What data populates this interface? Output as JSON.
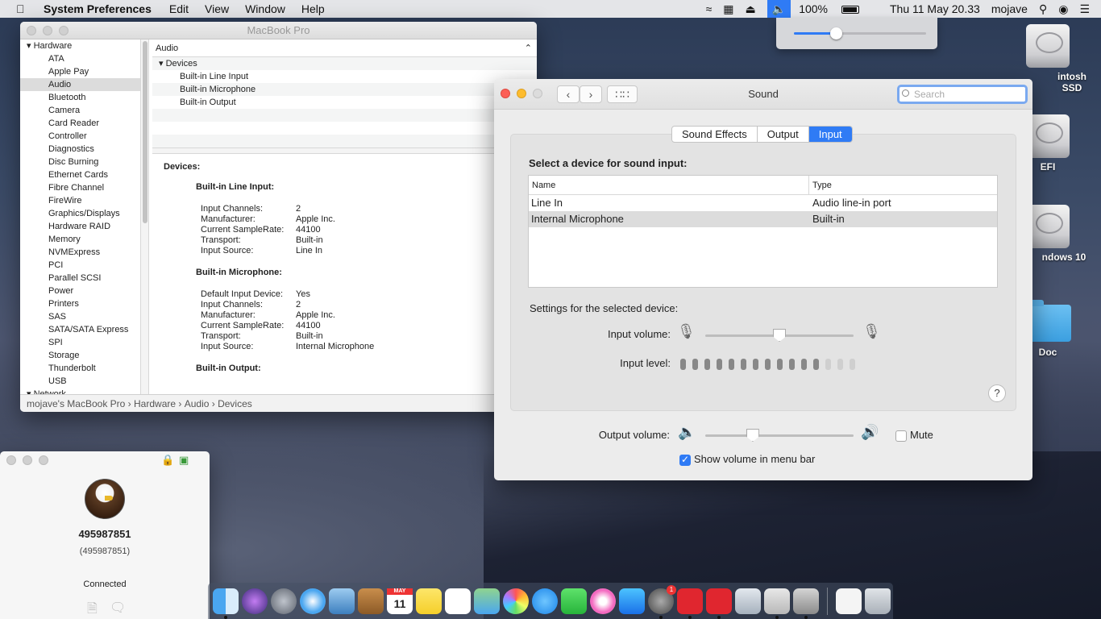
{
  "menubar": {
    "app": "System Preferences",
    "menus": [
      "Edit",
      "View",
      "Window",
      "Help"
    ],
    "battery": "100%",
    "clock": "Thu 11 May  20.33",
    "user": "mojave"
  },
  "volume_popup": {
    "level": 0.32
  },
  "desktop": {
    "icons": [
      "intosh SSD",
      "EFI",
      "ndows 10",
      "Doc"
    ]
  },
  "sysinfo": {
    "title": "MacBook Pro",
    "sidebar": {
      "group_hardware": "Hardware",
      "items": [
        "ATA",
        "Apple Pay",
        "Audio",
        "Bluetooth",
        "Camera",
        "Card Reader",
        "Controller",
        "Diagnostics",
        "Disc Burning",
        "Ethernet Cards",
        "Fibre Channel",
        "FireWire",
        "Graphics/Displays",
        "Hardware RAID",
        "Memory",
        "NVMExpress",
        "PCI",
        "Parallel SCSI",
        "Power",
        "Printers",
        "SAS",
        "SATA/SATA Express",
        "SPI",
        "Storage",
        "Thunderbolt",
        "USB"
      ],
      "group_network": "Network",
      "selected": "Audio"
    },
    "column_header": "Audio",
    "tree": {
      "group": "Devices",
      "rows": [
        "Built-in Line Input",
        "Built-in Microphone",
        "Built-in Output"
      ]
    },
    "detail": {
      "heading": "Devices:",
      "line_input_title": "Built-in Line Input:",
      "line_input": [
        [
          "Input Channels:",
          "2"
        ],
        [
          "Manufacturer:",
          "Apple Inc."
        ],
        [
          "Current SampleRate:",
          "44100"
        ],
        [
          "Transport:",
          "Built-in"
        ],
        [
          "Input Source:",
          "Line In"
        ]
      ],
      "mic_title": "Built-in Microphone:",
      "mic": [
        [
          "Default Input Device:",
          "Yes"
        ],
        [
          "Input Channels:",
          "2"
        ],
        [
          "Manufacturer:",
          "Apple Inc."
        ],
        [
          "Current SampleRate:",
          "44100"
        ],
        [
          "Transport:",
          "Built-in"
        ],
        [
          "Input Source:",
          "Internal Microphone"
        ]
      ],
      "output_title": "Built-in Output:"
    },
    "pathbar": [
      "mojave's MacBook Pro",
      "Hardware",
      "Audio",
      "Devices"
    ]
  },
  "sound": {
    "title": "Sound",
    "search_placeholder": "Search",
    "tabs": [
      "Sound Effects",
      "Output",
      "Input"
    ],
    "active_tab": "Input",
    "select_label": "Select a device for sound input:",
    "table": {
      "col_name": "Name",
      "col_type": "Type",
      "rows": [
        {
          "name": "Line In",
          "type": "Audio line-in port"
        },
        {
          "name": "Internal Microphone",
          "type": "Built-in"
        }
      ],
      "selected": 1
    },
    "settings_label": "Settings for the selected device:",
    "input_volume_label": "Input volume:",
    "input_volume": 0.5,
    "input_level_label": "Input level:",
    "input_level": {
      "lit": 12,
      "total": 15
    },
    "output_volume_label": "Output volume:",
    "output_volume": 0.32,
    "mute_label": "Mute",
    "mute": false,
    "show_volume_label": "Show volume in menu bar",
    "show_volume": true,
    "help": "?"
  },
  "chat": {
    "name": "495987851",
    "sub": "(495987851)",
    "status": "Connected"
  },
  "dock": {
    "calendar_month": "MAY",
    "calendar_day": "11",
    "badge": "1"
  }
}
